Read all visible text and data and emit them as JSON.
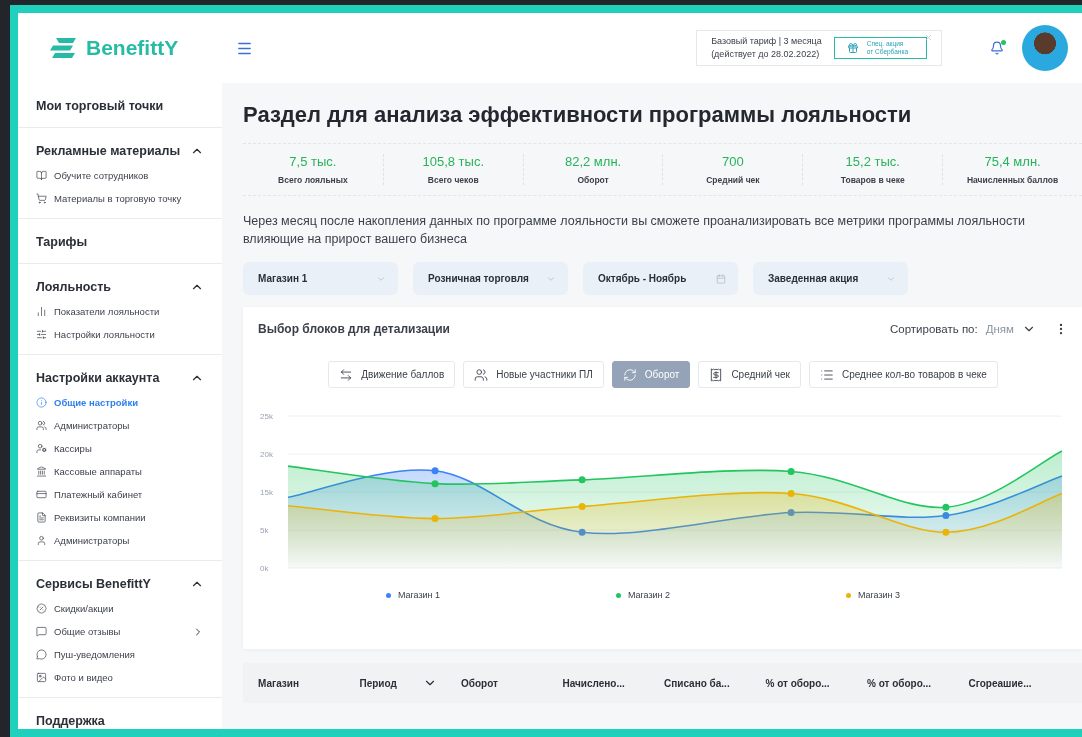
{
  "header": {
    "logo": "BenefittY",
    "tariff": {
      "line1": "Базовый тариф | 3 месяца",
      "line2": "(действует до 28.02.2022)"
    },
    "promo_button": {
      "line1": "Спец. акция",
      "line2": "от Сбербанка"
    },
    "notifications": {
      "unread": true
    }
  },
  "sidebar": {
    "sections": [
      {
        "title": "Мои торговый точки"
      },
      {
        "title": "Рекламные материалы",
        "expanded": true,
        "items": [
          {
            "label": "Обучите сотрудников",
            "selected": false
          },
          {
            "label": "Материалы в торговую точку",
            "selected": false
          }
        ]
      },
      {
        "title": "Тарифы"
      },
      {
        "title": "Лояльность",
        "expanded": true,
        "items": [
          {
            "label": "Показатели лояльности",
            "selected": false
          },
          {
            "label": "Настройки лояльности",
            "selected": false
          }
        ]
      },
      {
        "title": "Настройки аккаунта",
        "expanded": true,
        "items": [
          {
            "label": "Общие настройки",
            "selected": true
          },
          {
            "label": "Администраторы",
            "selected": false
          },
          {
            "label": "Кассиры",
            "selected": false
          },
          {
            "label": "Кассовые аппараты",
            "selected": false
          },
          {
            "label": "Платежный кабинет",
            "selected": false
          },
          {
            "label": "Реквизиты компании",
            "selected": false
          },
          {
            "label": "Администраторы",
            "selected": false
          }
        ]
      },
      {
        "title": "Сервисы BenefittY",
        "expanded": true,
        "items": [
          {
            "label": "Скидки/акции",
            "selected": false
          },
          {
            "label": "Общие отзывы",
            "selected": false,
            "has_submenu": true
          },
          {
            "label": "Пуш-уведомления",
            "selected": false
          },
          {
            "label": "Фото и видео",
            "selected": false
          }
        ]
      },
      {
        "title": "Поддержка"
      }
    ]
  },
  "page_title": "Раздел для анализа эффективности программы лояльности",
  "stats": [
    {
      "value": "7,5 тыс.",
      "label": "Всего лояльных"
    },
    {
      "value": "105,8 тыс.",
      "label": "Всего чеков"
    },
    {
      "value": "82,2 млн.",
      "label": "Оборот"
    },
    {
      "value": "700",
      "label": "Средний чек"
    },
    {
      "value": "15,2 тыс.",
      "label": "Товаров в чеке"
    },
    {
      "value": "75,4 млн.",
      "label": "Начисленных баллов"
    }
  ],
  "info_text": "Через месяц после накопления данных по программе лояльности вы сможете проанализировать все метрики программы лояльности  влияющие на прирост вашего бизнеса",
  "filters": [
    {
      "label": "Магазин 1",
      "kind": "dropdown"
    },
    {
      "label": "Розничная торговля",
      "kind": "dropdown"
    },
    {
      "label": "Октябрь - Ноябрь",
      "kind": "date"
    },
    {
      "label": "Заведенная акция",
      "kind": "dropdown"
    }
  ],
  "details": {
    "title": "Выбор блоков для детализации",
    "sort_label": "Сортировать по:",
    "sort_value": "Дням",
    "chips": [
      {
        "label": "Движение баллов",
        "selected": false
      },
      {
        "label": "Новые участники ПЛ",
        "selected": false
      },
      {
        "label": "Оборот",
        "selected": true
      },
      {
        "label": "Средний чек",
        "selected": false
      },
      {
        "label": "Среднее кол-во товаров в чеке",
        "selected": false
      }
    ],
    "chart": {
      "y_labels": [
        "25k",
        "20k",
        "15k",
        "5k",
        "0k"
      ],
      "series": [
        {
          "name": "Магазин 1",
          "color": "#3b82f6"
        },
        {
          "name": "Магазин 2",
          "color": "#22c55e"
        },
        {
          "name": "Магазин 3",
          "color": "#eab308"
        }
      ]
    }
  },
  "table": {
    "columns": [
      {
        "label": "Магазин"
      },
      {
        "label": "Период",
        "sortable": true
      },
      {
        "label": "Оборот"
      },
      {
        "label": "Начислено..."
      },
      {
        "label": "Списано ба..."
      },
      {
        "label": "% от оборо..."
      },
      {
        "label": "% от оборо..."
      },
      {
        "label": "Сгореашие..."
      }
    ]
  }
}
